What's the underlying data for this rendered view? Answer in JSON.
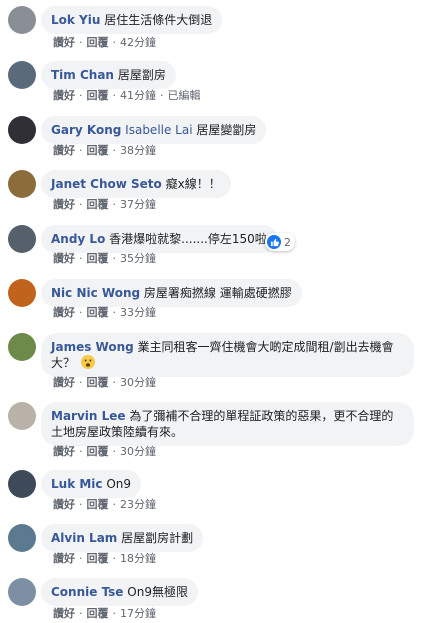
{
  "ui": {
    "like_label": "讚好",
    "reply_label": "回覆",
    "edited_label": "已編輯"
  },
  "comments": [
    {
      "author": "Lok Yiu",
      "text": "居住生活條件大倒退",
      "time": "42分鐘",
      "avatar_color": "#8a8f96"
    },
    {
      "author": "Tim Chan",
      "text": "居屋劏房",
      "time": "41分鐘",
      "edited": true,
      "avatar_color": "#5b6a7a"
    },
    {
      "author": "Gary Kong",
      "tagged": "Isabelle Lai",
      "text": "居屋變劏房",
      "time": "38分鐘",
      "avatar_color": "#2f2f35"
    },
    {
      "author": "Janet Chow Seto",
      "text": "癡x線！！",
      "time": "37分鐘",
      "avatar_color": "#8a6d3b"
    },
    {
      "author": "Andy Lo",
      "text": "香港爆啦就黎.......停左150啦",
      "time": "35分鐘",
      "reaction_count": "2",
      "avatar_color": "#55606b"
    },
    {
      "author": "Nic Nic Wong",
      "text": "房屋署痴撚線 運輸處硬撚膠",
      "time": "33分鐘",
      "avatar_color": "#c0641d"
    },
    {
      "author": "James Wong",
      "text": "業主同租客一齊住機會大啲定成間租/劏出去機會大？",
      "time": "30分鐘",
      "emoji": "frowning-face-emoji",
      "avatar_color": "#6d8a4a"
    },
    {
      "author": "Marvin Lee",
      "text": "為了彌補不合理的單程証政策的惡果，更不合理的土地房屋政策陸續有來。",
      "time": "30分鐘",
      "avatar_color": "#b8b2a8"
    },
    {
      "author": "Luk Mic",
      "text": "On9",
      "time": "23分鐘",
      "avatar_color": "#3e4a5a"
    },
    {
      "author": "Alvin Lam",
      "text": "居屋劏房計劃",
      "time": "18分鐘",
      "avatar_color": "#5c7a8f"
    },
    {
      "author": "Connie Tse",
      "text": "On9無極限",
      "time": "17分鐘",
      "avatar_color": "#7d8fa3"
    }
  ]
}
